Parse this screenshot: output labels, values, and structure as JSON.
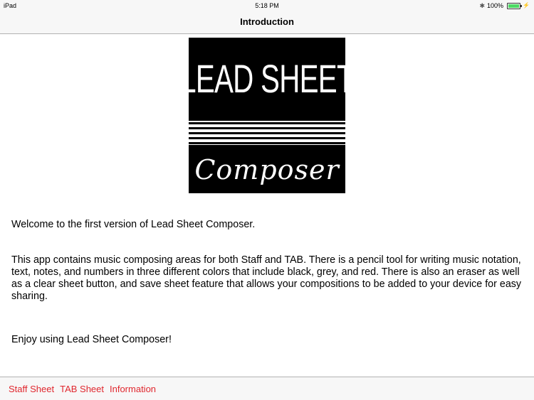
{
  "status_bar": {
    "device": "iPad",
    "time": "5:18 PM",
    "battery_percent": "100%",
    "battery_level": 1.0,
    "icons": [
      "bluetooth-icon",
      "battery-icon",
      "charging-icon"
    ]
  },
  "nav": {
    "title": "Introduction"
  },
  "logo": {
    "title": "LEAD SHEET",
    "subtitle": "Composer"
  },
  "content": {
    "welcome": "Welcome to the first version of Lead Sheet Composer.",
    "description": "This app contains music composing areas for both Staff and TAB.  There is a pencil tool for writing music notation, text, notes, and numbers in three different colors that include black, grey, and red.  There is also an eraser as well as a clear sheet button, and save sheet feature that allows your compositions to be added to your device for easy sharing.",
    "enjoy": "Enjoy using Lead Sheet Composer!"
  },
  "toolbar": {
    "items": [
      {
        "label": "Staff Sheet"
      },
      {
        "label": "TAB Sheet"
      },
      {
        "label": "Information"
      }
    ],
    "accent_color": "#e0272e"
  }
}
